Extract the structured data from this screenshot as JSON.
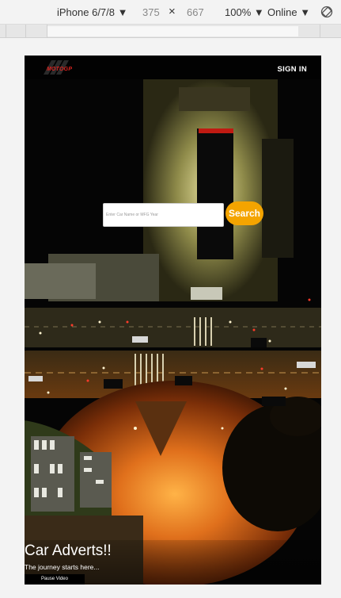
{
  "devtools": {
    "device": "iPhone 6/7/8 ▼",
    "width": "375",
    "times": "×",
    "height": "667",
    "zoom": "100% ▼",
    "network": "Online ▼",
    "rotate_icon": "rotate-icon"
  },
  "navbar": {
    "logo_text": "MOTOGP",
    "signin_label": "SIGN IN"
  },
  "search": {
    "placeholder": "Enter Car Name or MFG Year",
    "button_label": "Search"
  },
  "hero": {
    "title": "Car Adverts!!",
    "subtitle": "The journey starts here...",
    "pause_label": "Pause Video"
  },
  "colors": {
    "accent": "#f4a400",
    "logo_red": "#d8231f",
    "navbar_bg": "#000000"
  }
}
